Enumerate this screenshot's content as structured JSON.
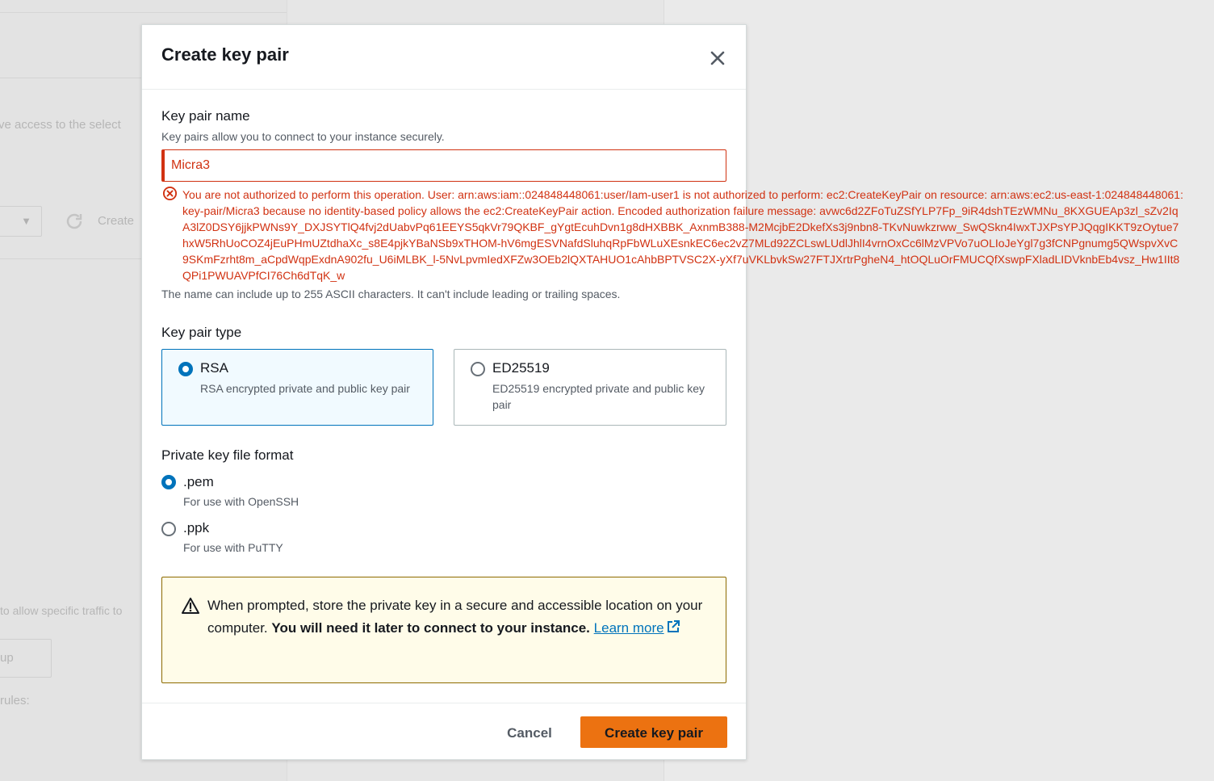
{
  "background": {
    "text_access": "ve access to the select",
    "text_create": "Create",
    "text_traffic": "to allow specific traffic to",
    "text_up": "up",
    "text_rules": "rules:"
  },
  "modal": {
    "title": "Create key pair",
    "close_icon": "close-icon",
    "key_pair_name": {
      "label": "Key pair name",
      "description": "Key pairs allow you to connect to your instance securely.",
      "value": "Micra3",
      "error_icon": "error-circle-icon",
      "error_message": "You are not authorized to perform this operation. User: arn:aws:iam::024848448061:user/Iam-user1 is not authorized to perform: ec2:CreateKeyPair on resource: arn:aws:ec2:us-east-1:024848448061:key-pair/Micra3 because no identity-based policy allows the ec2:CreateKeyPair action. Encoded authorization failure message: avwc6d2ZFoTuZSfYLP7Fp_9iR4dshTEzWMNu_8KXGUEAp3zl_sZv2IqA3lZ0DSY6jjkPWNs9Y_DXJSYTlQ4fvj2dUabvPq61EEYS5qkVr79QKBF_gYgtEcuhDvn1g8dHXBBK_AxnmB388-M2McjbE2DkefXs3j9nbn8-TKvNuwkzrww_SwQSkn4IwxTJXPsYPJQqgIKKT9zOytue7hxW5RhUoCOZ4jEuPHmUZtdhaXc_s8E4pjkYBaNSb9xTHOM-hV6mgESVNafdSluhqRpFbWLuXEsnkEC6ec2vZ7MLd92ZCLswLUdlJhlI4vrnOxCc6lMzVPVo7uOLIoJeYgl7g3fCNPgnumg5QWspvXvC9SKmFzrht8m_aCpdWqpExdnA902fu_U6iMLBK_l-5NvLpvmIedXFZw3OEb2lQXTAHUO1cAhbBPTVSC2X-yXf7uVKLbvkSw27FTJXrtrPgheN4_htOQLuOrFMUCQfXswpFXladLIDVknbEb4vsz_Hw1IIt8QPi1PWUAVPfCI76Ch6dTqK_w",
      "constraint": "The name can include up to 255 ASCII characters. It can't include leading or trailing spaces."
    },
    "key_pair_type": {
      "label": "Key pair type",
      "options": [
        {
          "title": "RSA",
          "description": "RSA encrypted private and public key pair",
          "selected": true
        },
        {
          "title": "ED25519",
          "description": "ED25519 encrypted private and public key pair",
          "selected": false
        }
      ]
    },
    "file_format": {
      "label": "Private key file format",
      "options": [
        {
          "title": ".pem",
          "description": "For use with OpenSSH",
          "selected": true
        },
        {
          "title": ".ppk",
          "description": "For use with PuTTY",
          "selected": false
        }
      ]
    },
    "alert": {
      "icon": "warning-icon",
      "text_plain": "When prompted, store the private key in a secure and accessible location on your computer.",
      "text_bold": "You will need it later to connect to your instance.",
      "link_text": "Learn more",
      "link_icon": "external-link-icon"
    },
    "footer": {
      "cancel_label": "Cancel",
      "submit_label": "Create key pair"
    }
  },
  "colors": {
    "error": "#d13212",
    "primary": "#ec7211",
    "link": "#0073bb",
    "alert_bg": "#fffce9"
  }
}
